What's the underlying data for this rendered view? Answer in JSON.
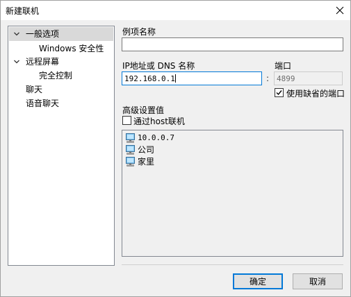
{
  "window": {
    "title": "新建联机"
  },
  "tree": {
    "items": [
      {
        "label": "一般选项",
        "expanded": true,
        "selected": true
      },
      {
        "label": "Windows 安全性"
      },
      {
        "label": "远程屏幕",
        "expanded": true
      },
      {
        "label": "完全控制"
      },
      {
        "label": "聊天"
      },
      {
        "label": "语音聊天"
      }
    ]
  },
  "form": {
    "name_label": "例项名称",
    "name_value": "",
    "ip_label": "IP地址或 DNS 名称",
    "ip_value": "192.168.0.1",
    "colon": ":",
    "port_label": "端口",
    "port_value": "4899",
    "default_port_label": "使用缺省的端口",
    "default_port_checked": true,
    "advanced_label": "高级设置值",
    "via_host_label": "通过host联机",
    "via_host_checked": false
  },
  "host_list": [
    {
      "label": "10.0.0.7",
      "icon": "computer-icon"
    },
    {
      "label": "公司",
      "icon": "computer-icon"
    },
    {
      "label": "家里",
      "icon": "computer-icon"
    }
  ],
  "buttons": {
    "ok": "确定",
    "cancel": "取消"
  },
  "colors": {
    "accent": "#0078d7",
    "selection": "#d9d9d9"
  }
}
